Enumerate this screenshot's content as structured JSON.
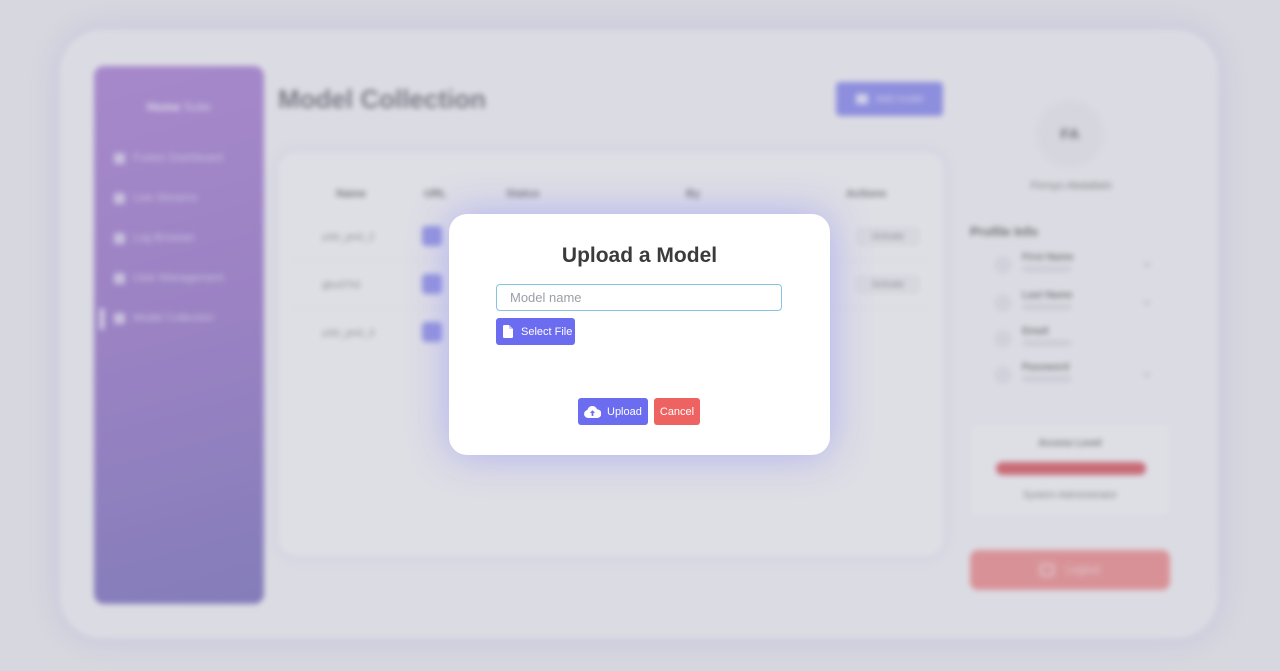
{
  "sidebar": {
    "brand_bold": "Home",
    "brand_rest": "Suite",
    "items": [
      {
        "label": "Fusion Dashboard",
        "icon": "dashboard-icon"
      },
      {
        "label": "Live Streams",
        "icon": "camera-icon"
      },
      {
        "label": "Log Browser",
        "icon": "log-icon"
      },
      {
        "label": "User Management",
        "icon": "users-icon"
      },
      {
        "label": "Model Collection",
        "icon": "model-icon",
        "active": true
      }
    ]
  },
  "main": {
    "title": "Model Collection",
    "add_button_label": "Add model",
    "table": {
      "headers": [
        "Name",
        "URL",
        "Status",
        "By",
        "Actions"
      ],
      "rows": [
        {
          "name": "yolo_prot_2",
          "action": "Activate"
        },
        {
          "name": "gbvd7h3",
          "action": "Activate"
        },
        {
          "name": "yolo_prot_3",
          "action": ""
        }
      ]
    }
  },
  "profile": {
    "initials": "FA",
    "name": "Firmyo Abdallahi",
    "info_heading": "Profile Info",
    "fields": [
      {
        "label": "First Name"
      },
      {
        "label": "Last Name"
      },
      {
        "label": "Email"
      },
      {
        "label": "Password"
      }
    ],
    "access_title": "Access Level",
    "access_role": "System Administrator",
    "logout_label": "Logout"
  },
  "modal": {
    "title": "Upload a Model",
    "model_name_placeholder": "Model name",
    "model_name_value": "",
    "select_file_label": "Select File",
    "upload_label": "Upload",
    "cancel_label": "Cancel",
    "colors": {
      "primary": "#6c6cf0",
      "danger": "#ef6262",
      "input_border": "#86c5e0"
    }
  }
}
